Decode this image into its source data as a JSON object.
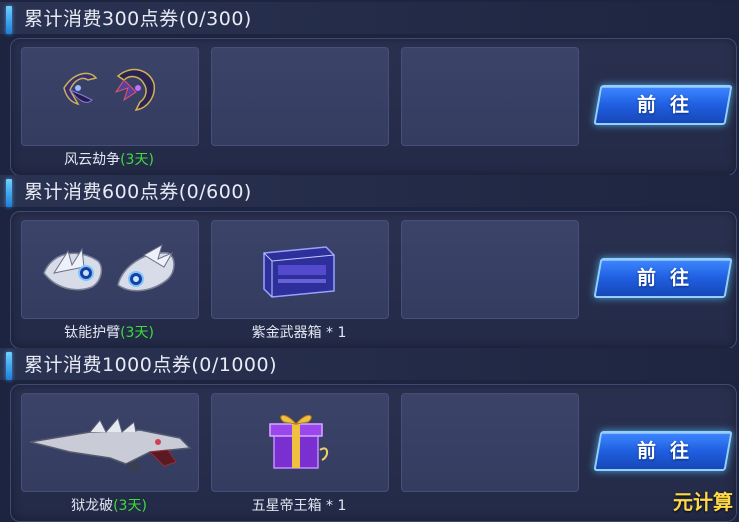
{
  "sections": [
    {
      "title": "累计消费300点券(0/300)",
      "goto_label": "前往",
      "rewards": [
        {
          "name": "风云劫争",
          "duration": "(3天)",
          "icon": "claw-weapon-icon"
        },
        {
          "name": "",
          "duration": "",
          "icon": ""
        },
        {
          "name": "",
          "duration": "",
          "icon": ""
        }
      ]
    },
    {
      "title": "累计消费600点券(0/600)",
      "goto_label": "前往",
      "rewards": [
        {
          "name": "钛能护臂",
          "duration": "(3天)",
          "icon": "armguard-icon"
        },
        {
          "name": "紫金武器箱 * 1",
          "duration": "",
          "icon": "weapon-box-icon"
        },
        {
          "name": "",
          "duration": "",
          "icon": ""
        }
      ]
    },
    {
      "title": "累计消费1000点券(0/1000)",
      "goto_label": "前往",
      "rewards": [
        {
          "name": "狱龙破",
          "duration": "(3天)",
          "icon": "dragon-rifle-icon"
        },
        {
          "name": "五星帝王箱 * 1",
          "duration": "",
          "icon": "gift-box-icon"
        },
        {
          "name": "",
          "duration": "",
          "icon": ""
        }
      ]
    }
  ],
  "watermark": "元计算",
  "colors": {
    "duration": "#3ddc3d",
    "button": "#1f5fe0",
    "panel": "#232a47"
  }
}
